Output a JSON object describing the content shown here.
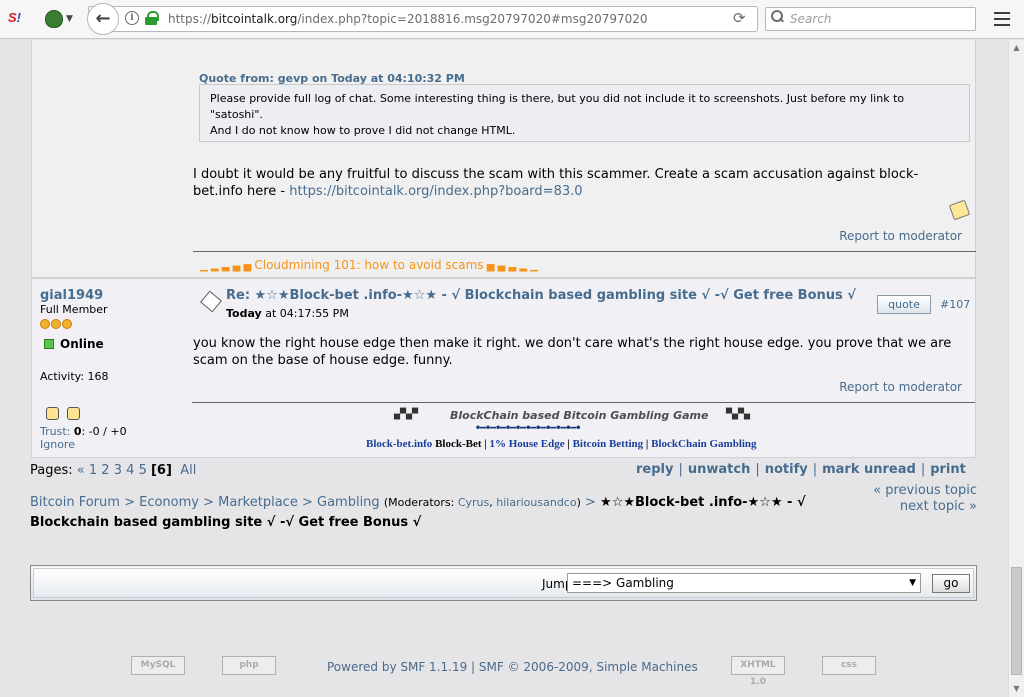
{
  "browser": {
    "logo": {
      "left": "S",
      "right": "!"
    },
    "url_prefix": "https://",
    "url_domain": "bitcointalk.org",
    "url_rest": "/index.php?topic=2018816.msg20797020#msg20797020",
    "search_placeholder": "Search"
  },
  "post1": {
    "quote_header": "Quote from: gevp on Today at 04:10:32 PM",
    "quote_line1": "Please provide full log of chat. Some interesting thing is there, but you did not include it to screenshots. Just before my link to",
    "quote_line2": "\"satoshi\".",
    "quote_line3": "And I do not know how to prove I did not change HTML.",
    "body": "I doubt it would be any fruitful to discuss the scam with this scammer. Create a scam accusation against block-bet.info here - ",
    "body_link": "https://bitcointalk.org/index.php?board=83.0",
    "report": "Report to moderator",
    "signature": "Cloudmining 101: how to avoid scams"
  },
  "post2": {
    "poster": "gial1949",
    "rank": "Full Member",
    "online": "Online",
    "activity": "Activity: 168",
    "trust_label": "Trust: ",
    "trust_value": "0",
    "trust_rest": ": -0 / +0",
    "ignore": "Ignore",
    "subject": "Re: ★☆★Block-bet .info-★☆★ - √ Blockchain based gambling site √ -√ Get free Bonus √",
    "date_bold": "Today",
    "date_rest": " at 04:17:55 PM",
    "quote_button": "quote",
    "msg_number": "#107",
    "body": "you know the right house edge then make it right. we don't care what's the right house edge. you prove that we are scam on the base of house edge. funny.",
    "report": "Report to moderator",
    "sig_title": "BlockChain based Bitcoin Gambling Game",
    "sig_link1": "Block-bet.info",
    "sig_link1_text": " Block-Bet",
    "sig_link2": "1% House Edge",
    "sig_link3": "Bitcoin Betting",
    "sig_link4": "BlockChain Gambling"
  },
  "pagination": {
    "label": "Pages:",
    "prev": "«",
    "pages": [
      "1",
      "2",
      "3",
      "4",
      "5"
    ],
    "current": "[6]",
    "all": "All"
  },
  "actions": [
    "reply",
    "unwatch",
    "notify",
    "mark unread",
    "print"
  ],
  "breadcrumb": {
    "forum": "Bitcoin Forum",
    "economy": "Economy",
    "marketplace": "Marketplace",
    "gambling": "Gambling",
    "moderators_label": "(Moderators: ",
    "mod1": "Cyrus",
    "mod2": "hilariousandco",
    "moderators_end": ")",
    "topic": "★☆★Block-bet .info-★☆★ - √ Blockchain based gambling site √ -√ Get free Bonus √"
  },
  "topic_nav": {
    "previous": "« previous topic",
    "next": "next topic »"
  },
  "jump": {
    "label": "Jump to:",
    "selected": "===> Gambling",
    "go": "go"
  },
  "footer": {
    "powered": "Powered by SMF 1.1.19",
    "copyright": "SMF © 2006-2009, Simple Machines",
    "badges": [
      "MySQL",
      "php",
      "XHTML 1.0",
      "css"
    ]
  },
  "colors": {
    "link": "#476c8e",
    "signature_orange": "#f7931a",
    "online_green": "#5ac54a"
  }
}
